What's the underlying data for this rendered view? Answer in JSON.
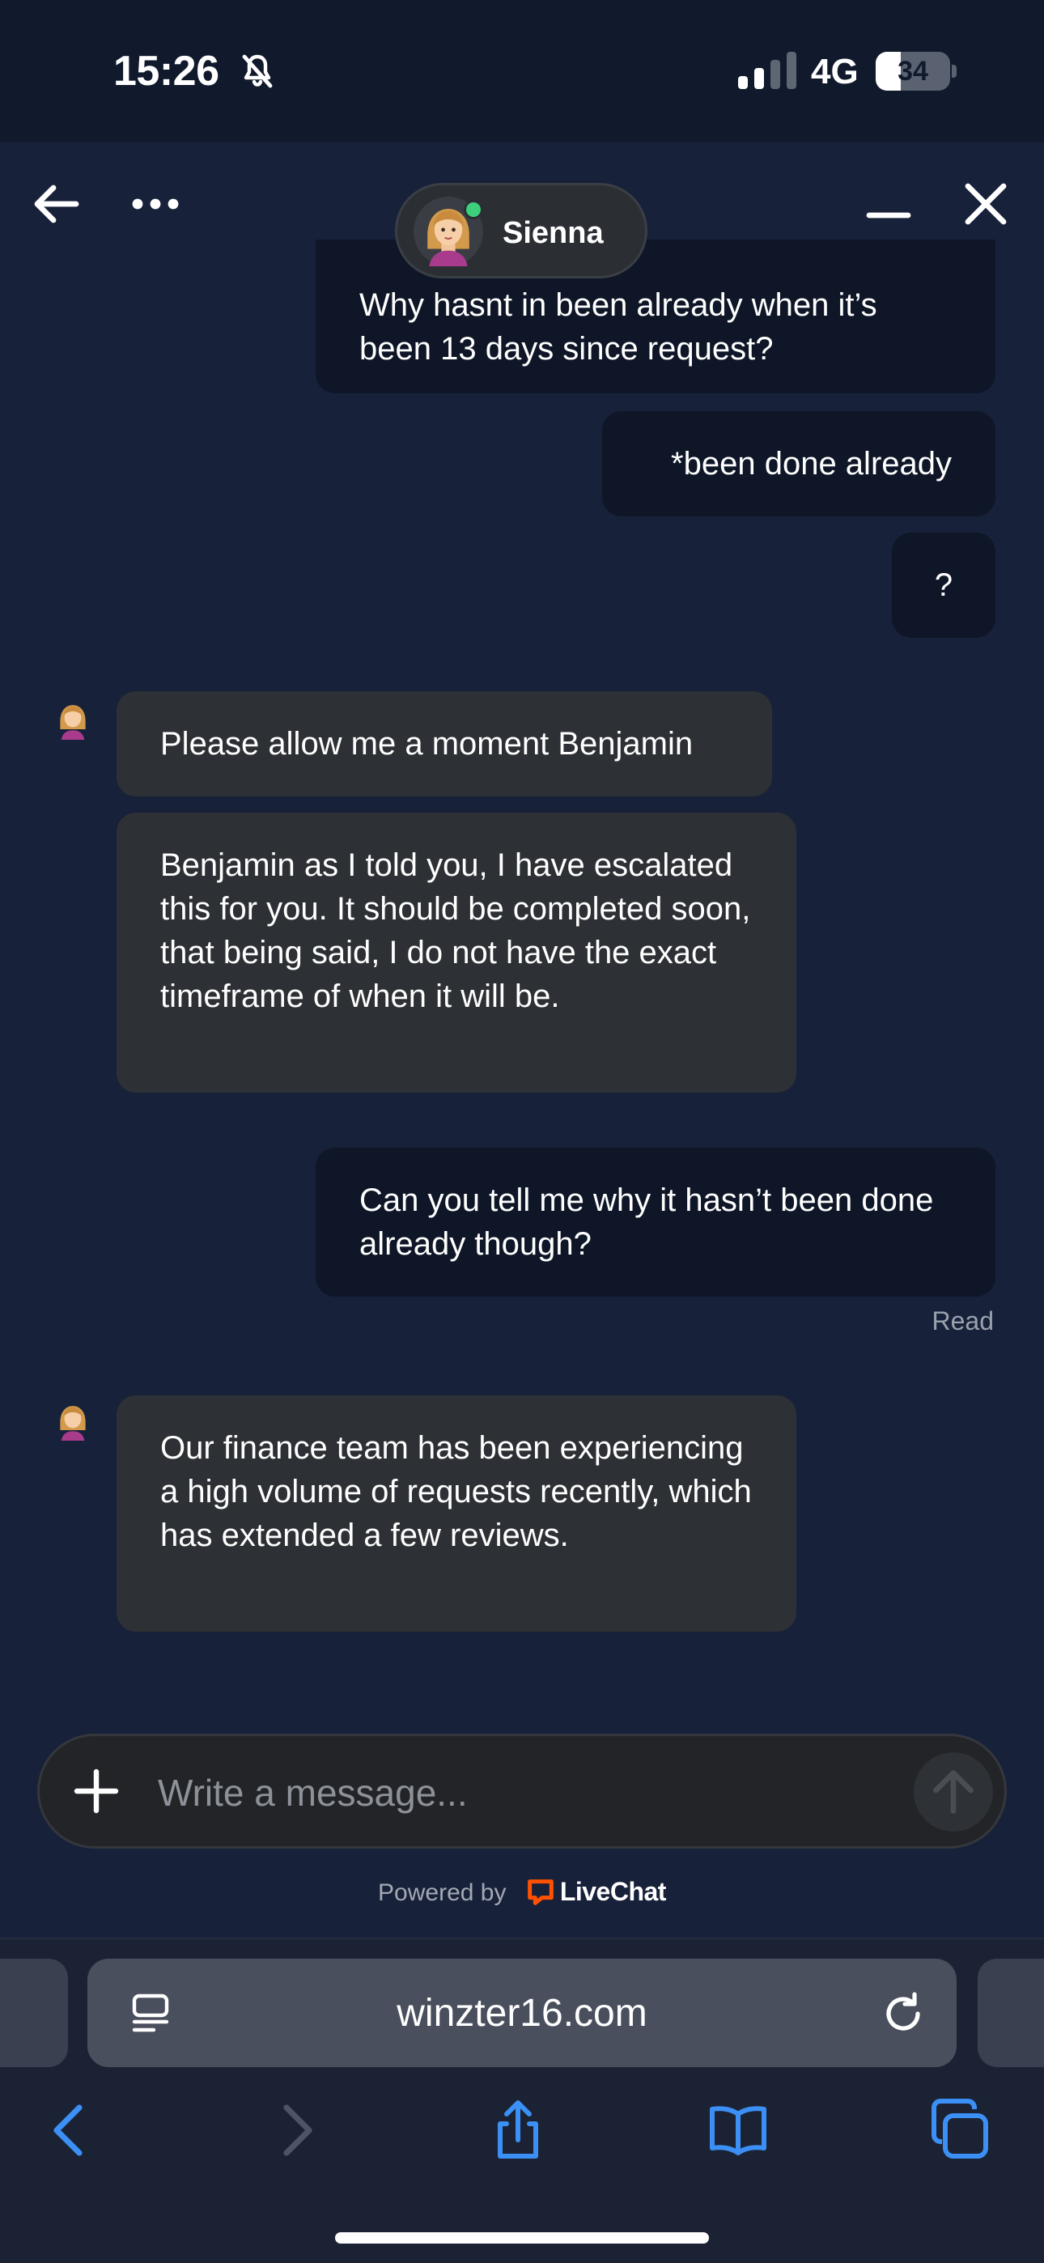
{
  "status_bar": {
    "time": "15:26",
    "network": "4G",
    "battery": "34",
    "battery_level": 0.34
  },
  "header": {
    "agent_name": "Sienna",
    "agent_status": "online",
    "icons": [
      "back-arrow-icon",
      "more-options-icon",
      "minimize-icon",
      "close-icon"
    ]
  },
  "messages": [
    {
      "from": "visitor",
      "text": "Why hasnt in been already when it’s been 13 days since request?"
    },
    {
      "from": "visitor",
      "text": "*been done already"
    },
    {
      "from": "visitor",
      "text": "?"
    },
    {
      "from": "agent",
      "text": "Please allow me a moment Benjamin"
    },
    {
      "from": "agent",
      "text": "Benjamin as I told you, I have escalated this for you. It should be completed soon, that being said, I do not have the exact timeframe of when it will be."
    },
    {
      "from": "visitor",
      "text": "Can you tell me why it hasn’t been done already though?"
    },
    {
      "from": "agent",
      "text": "Our finance team has been experiencing a high volume of requests recently, which has extended a few reviews."
    }
  ],
  "read_receipt": "Read",
  "composer": {
    "placeholder": "Write a message..."
  },
  "footer": {
    "powered_by": "Powered by",
    "brand": "LiveChat",
    "brand_color": "#ff5100"
  },
  "browser": {
    "url": "winzter16.com",
    "accent_color": "#3b8ff5"
  }
}
